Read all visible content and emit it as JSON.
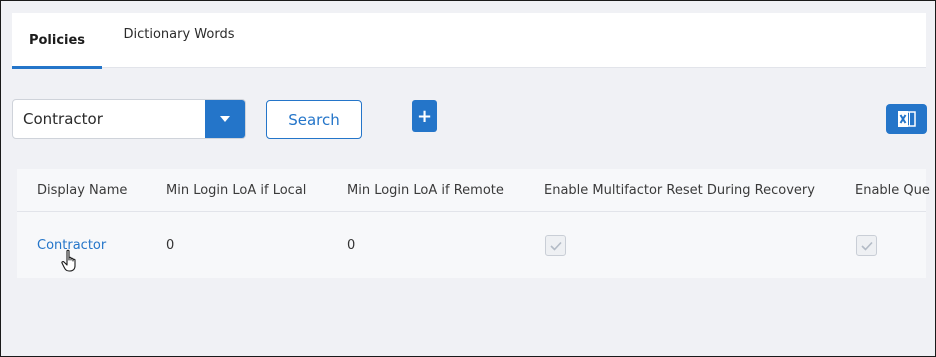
{
  "tabs": [
    {
      "label": "Policies",
      "active": true
    },
    {
      "label": "Dictionary Words",
      "active": false
    }
  ],
  "toolbar": {
    "select_value": "Contractor",
    "search_label": "Search",
    "add_icon": "+",
    "export_icon": "excel-icon"
  },
  "table": {
    "headers": [
      "Display Name",
      "Min Login LoA if Local",
      "Min Login LoA if Remote",
      "Enable Multifactor Reset During Recovery",
      "Enable Que"
    ],
    "rows": [
      {
        "display_name": "Contractor",
        "min_local": "0",
        "min_remote": "0",
        "multifactor_reset": true,
        "enable_que": true
      }
    ]
  },
  "colors": {
    "accent": "#2475c9",
    "background": "#f0f1f5"
  }
}
